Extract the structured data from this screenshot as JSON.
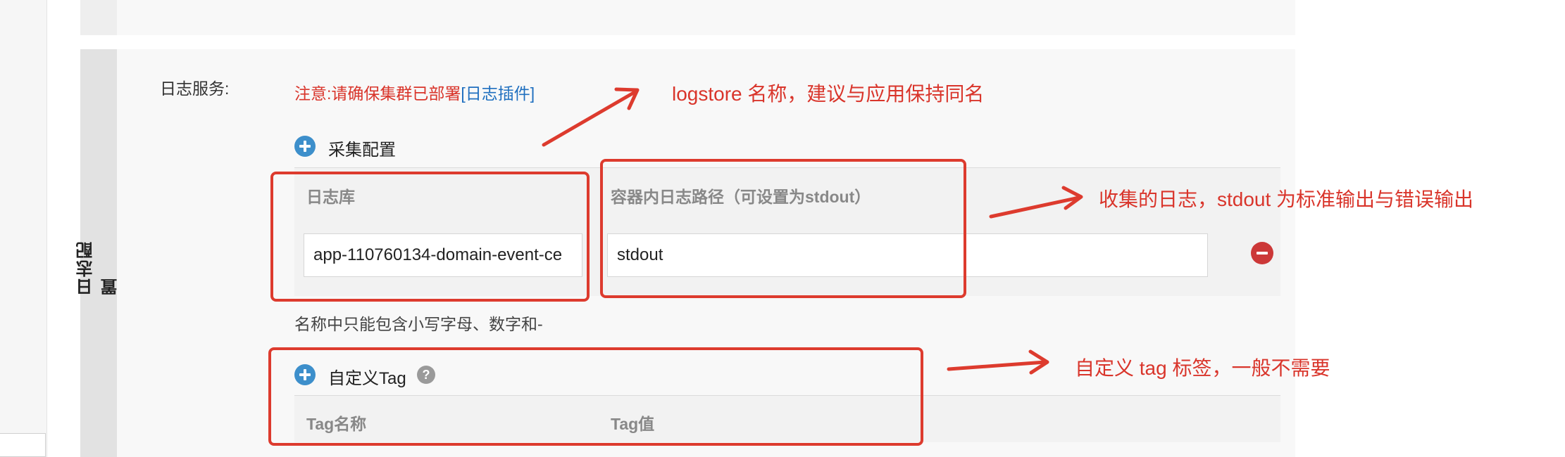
{
  "section": {
    "vertical_title": "日志配置"
  },
  "log_service": {
    "label": "日志服务:",
    "notice_text": "注意:请确保集群已部署",
    "notice_link": "[日志插件]"
  },
  "collect_config": {
    "title": "采集配置",
    "columns": [
      "日志库",
      "容器内日志路径（可设置为stdout）"
    ],
    "row": {
      "logstore_value": "app-110760134-domain-event-ce",
      "path_value": "stdout"
    },
    "help": "名称中只能包含小写字母、数字和-"
  },
  "custom_tag": {
    "title": "自定义Tag",
    "help_icon": "?",
    "columns": [
      "Tag名称",
      "Tag值"
    ]
  },
  "annotations": {
    "logstore": "logstore 名称，建议与应用保持同名",
    "path": "收集的日志，stdout 为标准输出与错误输出",
    "tag": "自定义 tag 标签，一般不需要"
  },
  "colors": {
    "annotation_red": "#dd3b2e",
    "primary_blue": "#3d8fcb",
    "danger": "#cc3838"
  }
}
